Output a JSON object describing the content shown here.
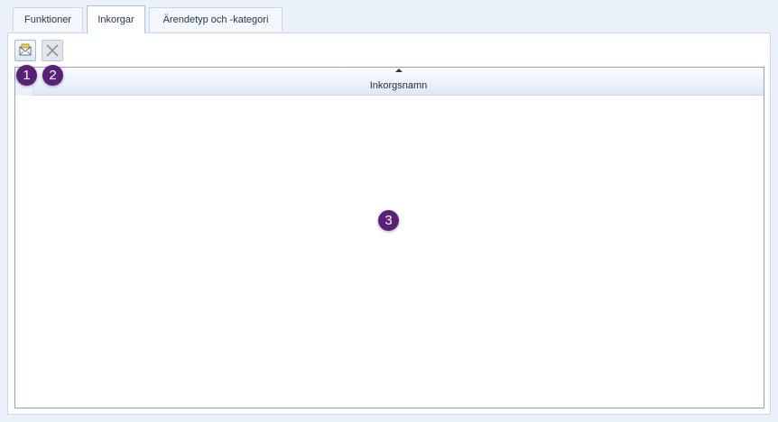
{
  "tabs": [
    {
      "label": "Funktioner",
      "active": false
    },
    {
      "label": "Inkorgar",
      "active": true
    },
    {
      "label": "Ärendetyp och -kategori",
      "active": false
    }
  ],
  "toolbar": {
    "add_icon": "mailbox-add-icon",
    "delete_icon": "close-icon"
  },
  "grid": {
    "column_header": "Inkorgsnamn",
    "sort": "ascending",
    "rows": []
  },
  "annotations": {
    "badge_1": "1",
    "badge_2": "2",
    "badge_3": "3"
  },
  "colors": {
    "badge": "#5a1f78",
    "background": "#eaf1fb",
    "border": "#c9d7ea"
  }
}
